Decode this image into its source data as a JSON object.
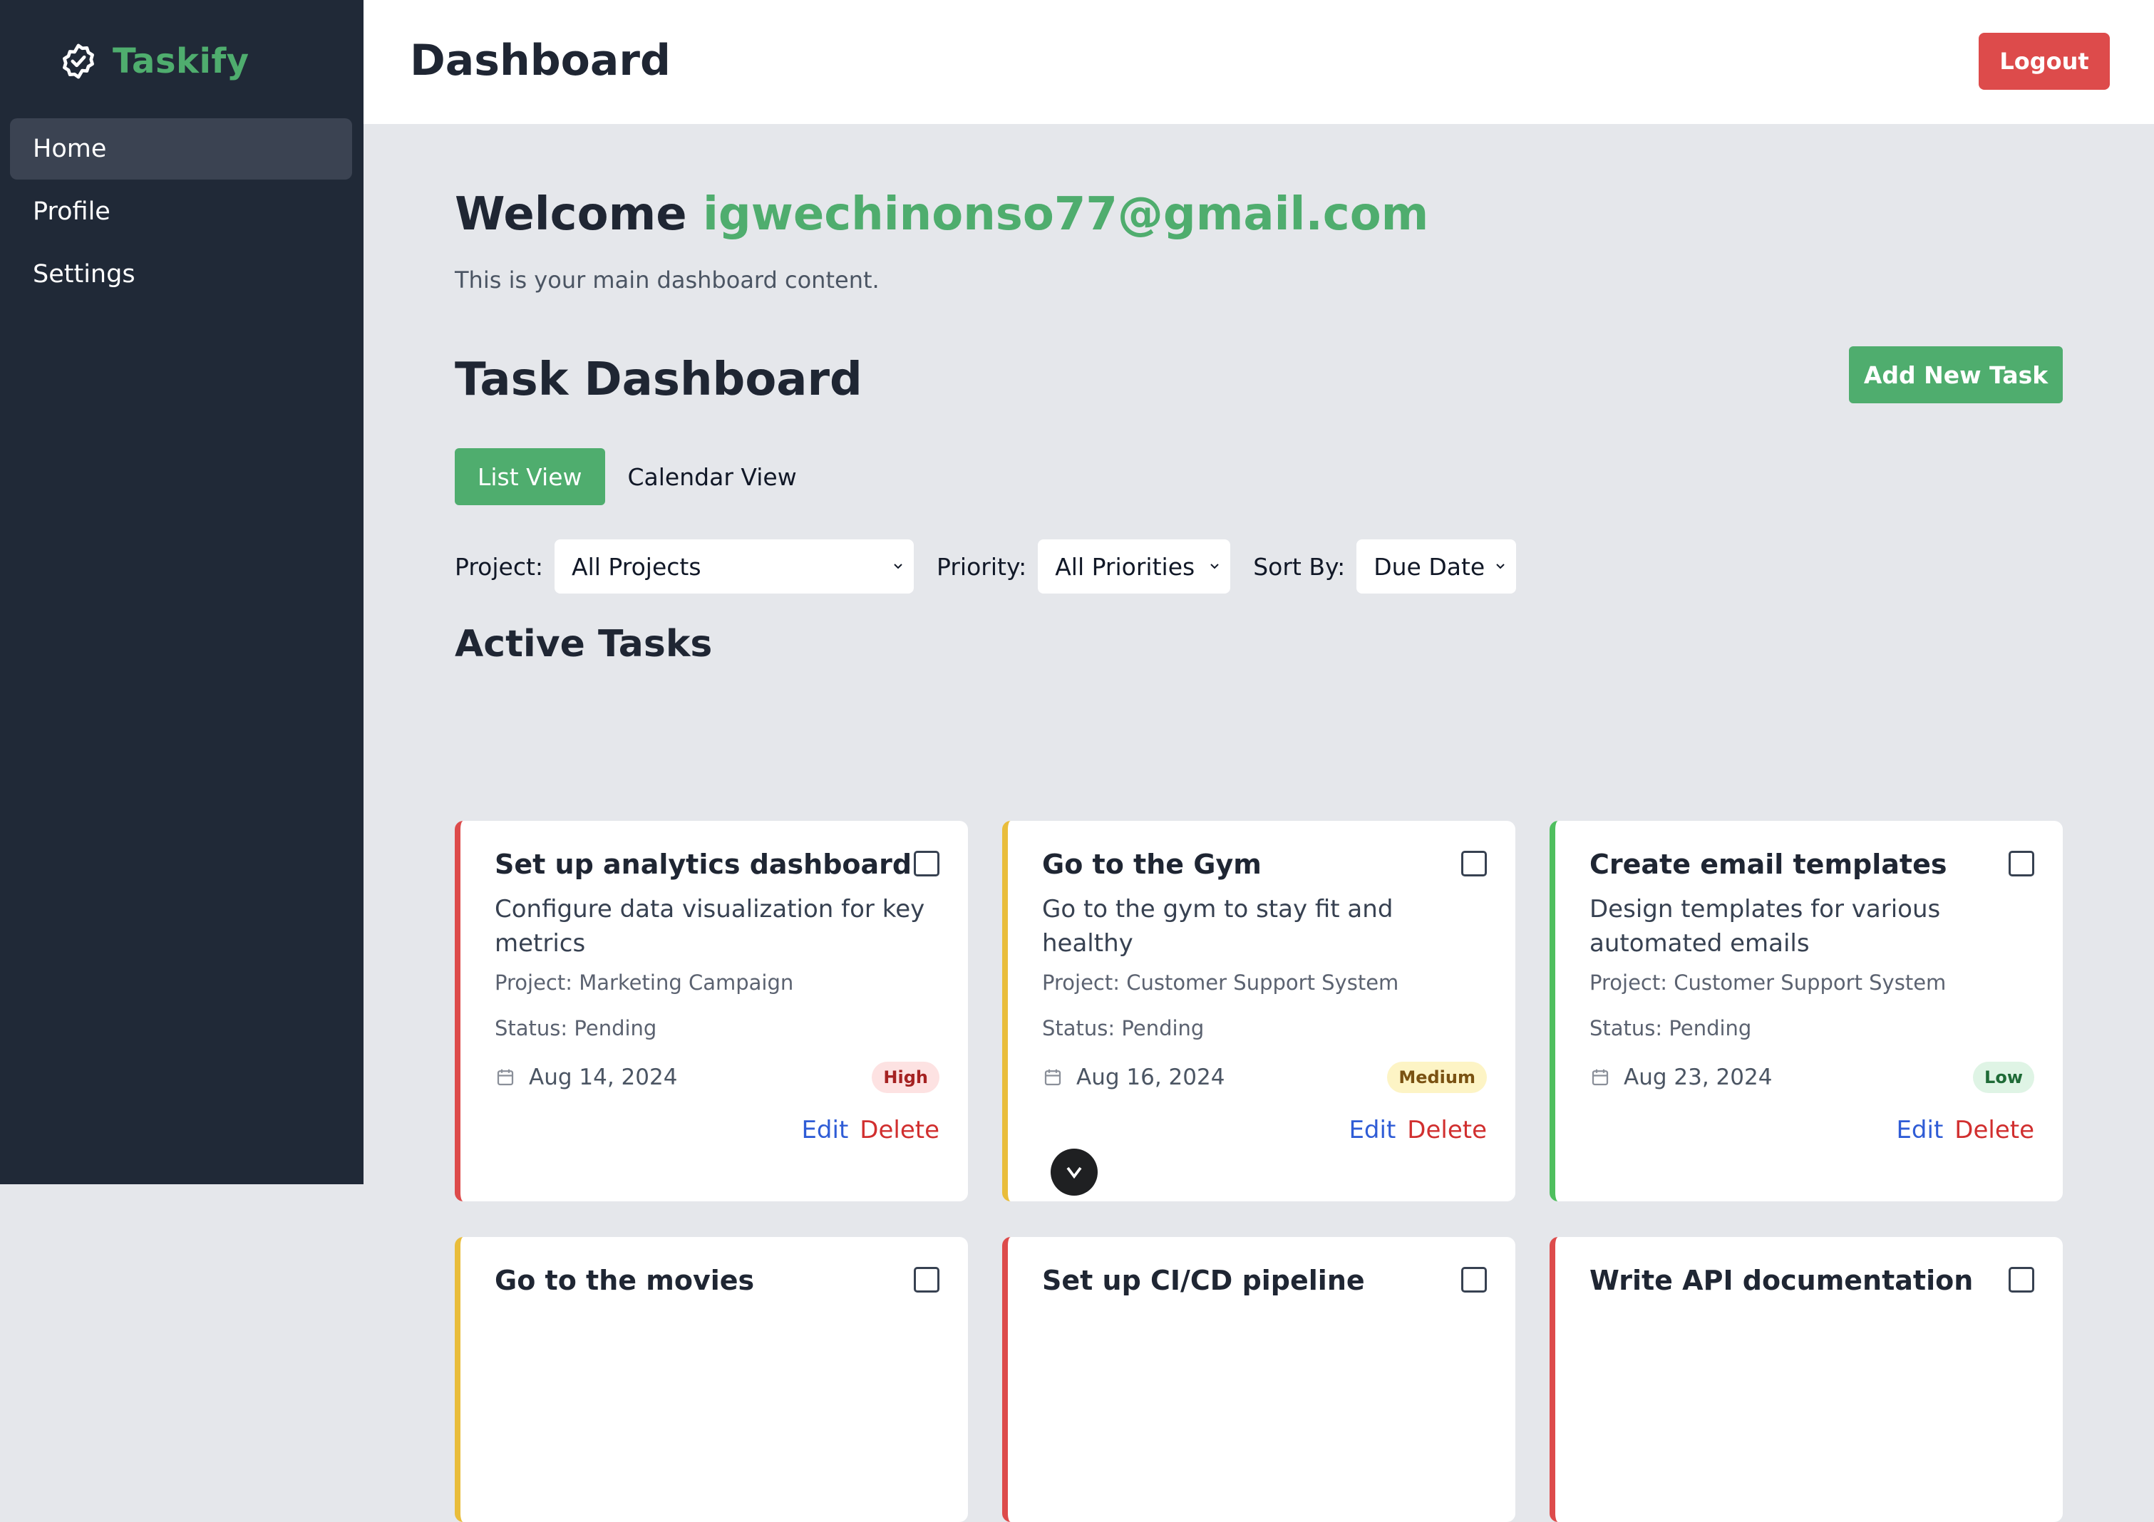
{
  "app": {
    "name": "Taskify",
    "accent": "#4fad6e"
  },
  "sidebar": {
    "items": [
      {
        "label": "Home",
        "active": true
      },
      {
        "label": "Profile",
        "active": false
      },
      {
        "label": "Settings",
        "active": false
      }
    ]
  },
  "header": {
    "title": "Dashboard",
    "logout_label": "Logout"
  },
  "welcome": {
    "prefix": "Welcome",
    "email": "igwechinonso77@gmail.com",
    "subtitle": "This is your main dashboard content."
  },
  "task_dashboard": {
    "title": "Task Dashboard",
    "add_label": "Add New Task",
    "views": [
      {
        "label": "List View",
        "active": true
      },
      {
        "label": "Calendar View",
        "active": false
      }
    ],
    "filters": {
      "project": {
        "label": "Project:",
        "value": "All Projects"
      },
      "priority": {
        "label": "Priority:",
        "value": "All Priorities"
      },
      "sort": {
        "label": "Sort By:",
        "value": "Due Date"
      }
    },
    "active_title": "Active Tasks"
  },
  "tasks": [
    {
      "title": "Set up analytics dashboard",
      "description": "Configure data visualization for key metrics",
      "project": "Project: Marketing Campaign",
      "status": "Status: Pending",
      "date": "Aug 14, 2024",
      "priority": "High",
      "color": "#dd4b4b"
    },
    {
      "title": "Go to the Gym",
      "description": "Go to the gym to stay fit and healthy",
      "project": "Project: Customer Support System",
      "status": "Status: Pending",
      "date": "Aug 16, 2024",
      "priority": "Medium",
      "color": "#e9bd3b"
    },
    {
      "title": "Create email templates",
      "description": "Design templates for various automated emails",
      "project": "Project: Customer Support System",
      "status": "Status: Pending",
      "date": "Aug 23, 2024",
      "priority": "Low",
      "color": "#4fbf5e"
    },
    {
      "title": "Go to the movies",
      "color": "#e9bd3b"
    },
    {
      "title": "Set up CI/CD pipeline",
      "color": "#dd4b4b"
    },
    {
      "title": "Write API documentation",
      "color": "#dd4b4b"
    }
  ],
  "actions": {
    "edit": "Edit",
    "delete": "Delete"
  }
}
